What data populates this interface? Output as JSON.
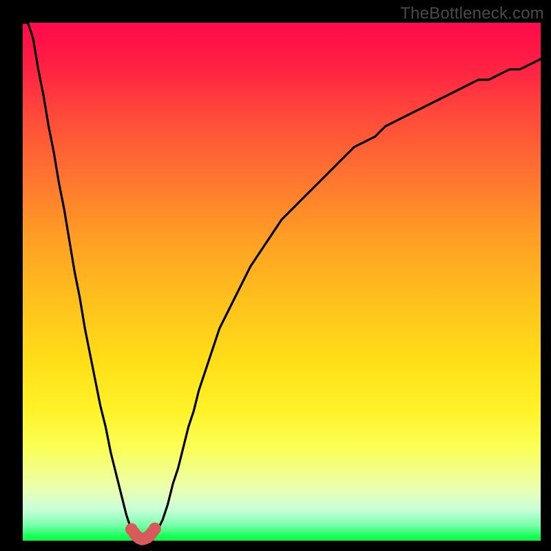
{
  "attribution": "TheBottleneck.com",
  "colors": {
    "frame": "#000000",
    "curve": "#000000",
    "point": "#d85a5a",
    "gradient_top": "#ff0a4a",
    "gradient_bottom": "#00ff3c"
  },
  "chart_data": {
    "type": "line",
    "title": "",
    "xlabel": "",
    "ylabel": "",
    "xlim": [
      0,
      100
    ],
    "ylim": [
      0,
      100
    ],
    "x": [
      0,
      1,
      2,
      3,
      4,
      5,
      6,
      7,
      8,
      9,
      10,
      11,
      12,
      13,
      14,
      15,
      16,
      17,
      18,
      19,
      20,
      21,
      22,
      23,
      24,
      25,
      26,
      27,
      28,
      29,
      30,
      31,
      32,
      33,
      34,
      35,
      36,
      37,
      38,
      39,
      40,
      42,
      44,
      46,
      48,
      50,
      52,
      54,
      56,
      58,
      60,
      62,
      64,
      66,
      68,
      70,
      72,
      74,
      76,
      78,
      80,
      82,
      84,
      86,
      88,
      90,
      92,
      94,
      96,
      98,
      100
    ],
    "y": [
      100,
      100,
      97,
      91,
      86,
      80,
      75,
      69,
      64,
      58,
      52,
      47,
      41,
      36,
      31,
      26,
      22,
      17,
      13,
      9,
      5,
      2,
      1,
      0,
      0,
      1,
      2,
      4,
      7,
      11,
      14,
      18,
      22,
      25,
      29,
      32,
      35,
      38,
      41,
      43,
      45,
      49,
      53,
      56,
      59,
      62,
      64,
      66,
      68,
      70,
      72,
      74,
      76,
      77,
      78,
      80,
      81,
      82,
      83,
      84,
      85,
      86,
      87,
      88,
      89,
      89,
      90,
      91,
      91,
      92,
      93
    ],
    "highlight_points": {
      "x": [
        21.0,
        21.5,
        22.0,
        22.5,
        23.0,
        23.5,
        24.0,
        24.5,
        25.0,
        25.5
      ],
      "y": [
        2.2,
        1.5,
        0.9,
        0.5,
        0.3,
        0.4,
        0.6,
        1.0,
        1.6,
        2.3
      ]
    },
    "annotations": []
  }
}
